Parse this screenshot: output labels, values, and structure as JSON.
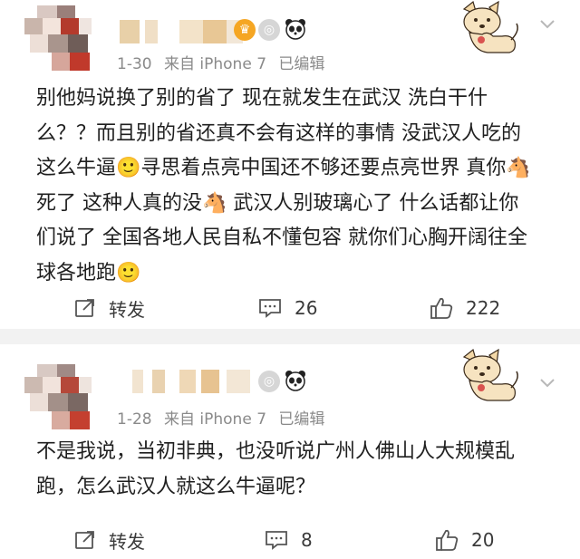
{
  "posts": [
    {
      "timestamp": "1-30",
      "source": "来自 iPhone 7",
      "edited": "已编辑",
      "content": "别他妈说换了别的省了 现在就发生在武汉 洗白干什么？？而且别的省还真不会有这样的事情 没武汉人吃的这么牛逼🙂寻思着点亮中国还不够还要点亮世界 真你🐴死了 这种人真的没🐴 武汉人别玻璃心了 什么话都让你们说了 全国各地人民自私不懂包容 就你们心胸开阔往全球各地跑🙂",
      "actions": {
        "repost_label": "转发",
        "comment_count": "26",
        "like_count": "222"
      }
    },
    {
      "timestamp": "1-28",
      "source": "来自 iPhone 7",
      "edited": "已编辑",
      "content": "不是我说，当初非典，也没听说广州人佛山人大规模乱跑，怎么武汉人就这么牛逼呢？",
      "actions": {
        "repost_label": "转发",
        "comment_count": "8",
        "like_count": "20"
      }
    }
  ],
  "icons": {
    "repost": "share-icon",
    "comment": "comment-icon",
    "like": "thumbs-up-icon",
    "more": "chevron-down-icon",
    "badge_crown": "crown-badge-icon",
    "badge_medal": "medal-badge-icon",
    "badge_panda": "panda-icon"
  },
  "colors": {
    "meta_text": "#8a8a8a",
    "body_text": "#1f1f1f",
    "separator": "#f2f2f2",
    "crown_badge": "#f5a623"
  }
}
